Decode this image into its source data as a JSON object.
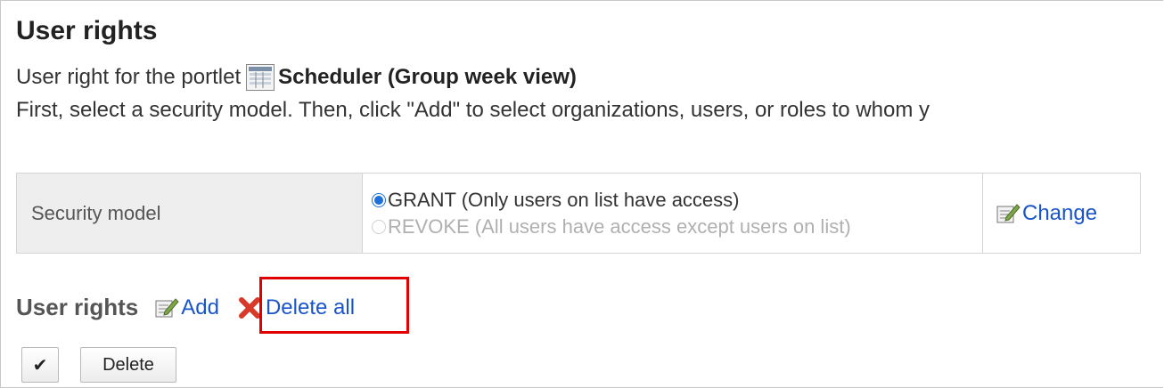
{
  "header": {
    "title": "User rights",
    "portlet_prefix": "User right for the portlet",
    "portlet_name": "Scheduler (Group week view)",
    "instruction": "First, select a security model. Then, click \"Add\" to select organizations, users, or roles to whom y"
  },
  "security_model": {
    "label": "Security model",
    "options": [
      {
        "label": "GRANT (Only users on list have access)",
        "checked": true,
        "enabled": true
      },
      {
        "label": "REVOKE (All users have access except users on list)",
        "checked": false,
        "enabled": false
      }
    ],
    "change_label": "Change"
  },
  "user_rights": {
    "title": "User rights",
    "add_label": "Add",
    "delete_all_label": "Delete all",
    "check_all_symbol": "✔",
    "delete_label": "Delete"
  },
  "colors": {
    "link": "#1a55c8",
    "highlight": "#e00000",
    "radio_checked": "#1e6fd9",
    "label_cell_bg": "#eeeeee"
  },
  "icons": {
    "portlet": "portlet-list-icon",
    "change": "edit-icon",
    "add": "edit-icon",
    "delete_all": "red-x-icon"
  }
}
